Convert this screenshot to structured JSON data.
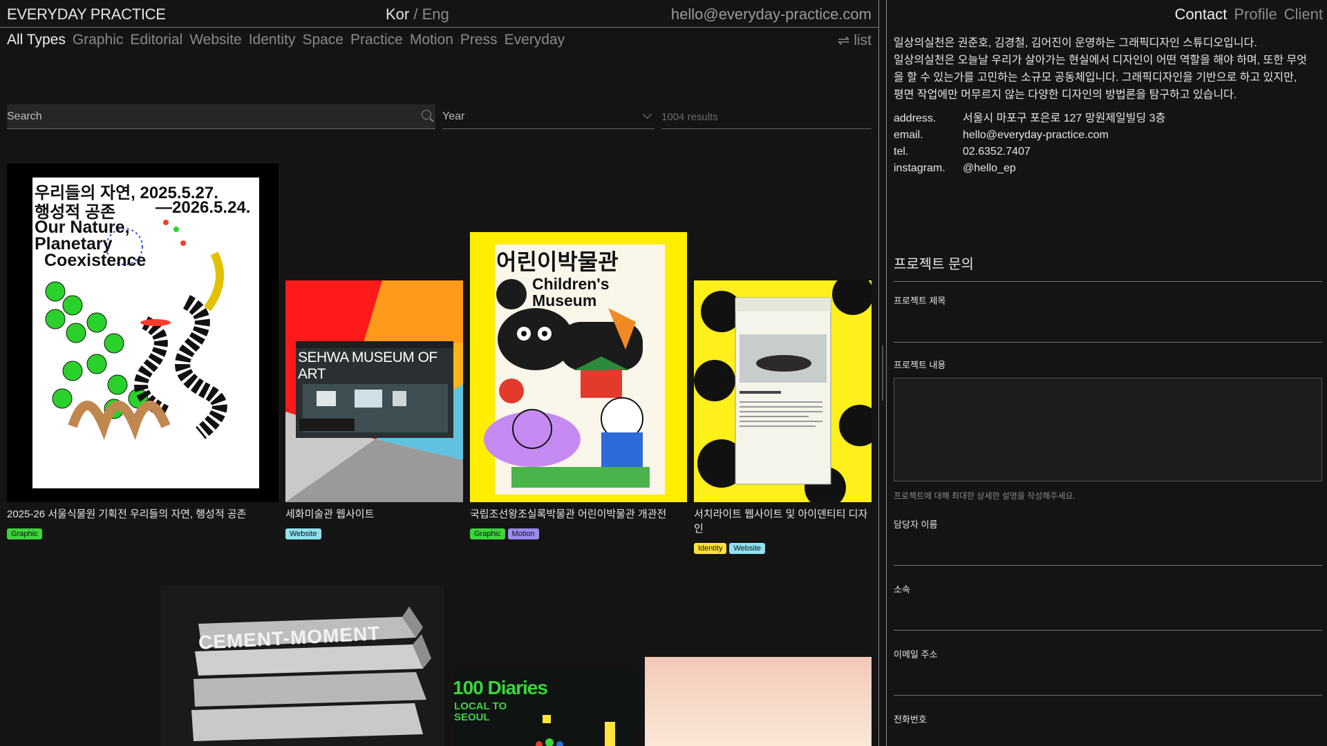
{
  "header": {
    "logo": "EVERYDAY PRACTICE",
    "lang_active": "Kor",
    "lang_sep": " / ",
    "lang_other": "Eng",
    "email": "hello@everyday-practice.com"
  },
  "filters": {
    "items": [
      "All Types",
      "Graphic",
      "Editorial",
      "Website",
      "Identity",
      "Space",
      "Practice",
      "Motion",
      "Press",
      "Everyday"
    ],
    "view_toggle": "⇌ list"
  },
  "search": {
    "placeholder": "Search"
  },
  "year": {
    "label": "Year"
  },
  "results": {
    "count": "1004 results"
  },
  "projects": [
    {
      "title": "2025-26 서울식물원 기획전 우리들의 자연, 행성적 공존",
      "tags": [
        "Graphic"
      ]
    },
    {
      "title": "세화미술관 웹사이트",
      "tags": [
        "Website"
      ]
    },
    {
      "title": "국립조선왕조실록박물관 어린이박물관 개관전",
      "tags": [
        "Graphic",
        "Motion"
      ]
    },
    {
      "title": "서치라이트 웹사이트 및 아이덴티티 디자인",
      "tags": [
        "Identity",
        "Website"
      ]
    }
  ],
  "thumbs": {
    "p1": {
      "l1": "우리들의 자연, 2025.5.27.",
      "l2": "행성적 공존",
      "l3": "—2026.5.24.",
      "l4": "Our Nature,",
      "l5": "Planetary",
      "l6": "Coexistence"
    },
    "p2": {
      "title": "SEHWA MUSEUM OF ART"
    },
    "p3": {
      "l1": "어린이박물관",
      "l2": "Children's",
      "l3": "Museum"
    },
    "p5": {
      "text": "CEMENT-MOMENT"
    },
    "p6": {
      "l1": "100 Diaries",
      "l2": "LOCAL TO",
      "l3": "SEOUL"
    }
  },
  "right_nav": [
    "Contact",
    "Profile",
    "Client"
  ],
  "intro": [
    "일상의실천은 권준호, 김경철, 김어진이 운영하는 그래픽디자인 스튜디오입니다.",
    "일상의실천은 오늘날 우리가 살아가는 현실에서 디자인이 어떤 역할을 해야 하며, 또한 무엇을 할 수 있는가를 고민하는 소규모 공동체입니다. 그래픽디자인을 기반으로 하고 있지만, 평면 작업에만 머무르지 않는 다양한 디자인의 방법론을 탐구하고 있습니다."
  ],
  "contact_info": [
    {
      "key": "address.",
      "value": "서울시 마포구 포은로 127 망원제일빌딩 3층"
    },
    {
      "key": "email.",
      "value": "hello@everyday-practice.com"
    },
    {
      "key": "tel.",
      "value": "02.6352.7407"
    },
    {
      "key": "instagram.",
      "value": "@hello_ep"
    }
  ],
  "form": {
    "title": "프로젝트 문의",
    "project_title": "프로젝트 제목",
    "project_content": "프로젝트 내용",
    "content_hint": "프로젝트에 대해 최대한 상세한 설명을 작성해주세요.",
    "manager_name": "담당자 이름",
    "affiliation": "소속",
    "email": "이메일 주소",
    "phone": "전화번호"
  },
  "colors": {
    "background": "#141414",
    "tag_graphic": "#3bd53b",
    "tag_website": "#8fe3f0",
    "tag_motion": "#9a8cf0",
    "tag_identity": "#ffe23a"
  }
}
